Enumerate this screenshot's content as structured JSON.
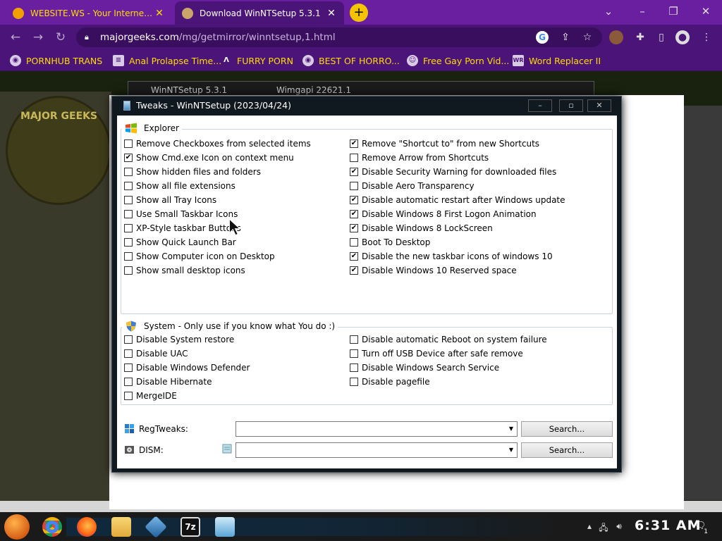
{
  "browser": {
    "tabs": [
      {
        "title": "WEBSITE.WS - Your Internet Ad",
        "active": false
      },
      {
        "title": "Download WinNTSetup 5.3.1",
        "active": true
      }
    ],
    "url_host": "majorgeeks.com",
    "url_path": "/mg/getmirror/winntsetup,1.html",
    "bookmarks": [
      "PORNHUB TRANS",
      "Anal Prolapse Time...",
      "FURRY PORN",
      "BEST OF HORRO...",
      "Free Gay Porn Vid...",
      "Word Replacer II"
    ],
    "colors": {
      "tabstrip": "#6a1fa0",
      "toolbar": "#4b1478",
      "bookmark_text": "#ffde00"
    }
  },
  "background_window": {
    "title": "WinNTSetup 5.3.1",
    "wimgapi": "Wimgapi 22621.1"
  },
  "dialog": {
    "title": "Tweaks - WinNTSetup (2023/04/24)",
    "explorer": {
      "legend": "Explorer",
      "left": [
        {
          "label": "Remove Checkboxes from selected items",
          "checked": false
        },
        {
          "label": "Show Cmd.exe Icon on context menu",
          "checked": true
        },
        {
          "label": "Show hidden files and folders",
          "checked": false
        },
        {
          "label": "Show all file extensions",
          "checked": false
        },
        {
          "label": "Show all Tray Icons",
          "checked": false
        },
        {
          "label": "Use Small Taskbar Icons",
          "checked": false
        },
        {
          "label": "XP-Style taskbar Buttons",
          "checked": false
        },
        {
          "label": "Show Quick Launch Bar",
          "checked": false
        },
        {
          "label": "Show Computer icon on Desktop",
          "checked": false
        },
        {
          "label": "Show small desktop icons",
          "checked": false
        }
      ],
      "right": [
        {
          "label": "Remove \"Shortcut to\" from new Shortcuts",
          "checked": true
        },
        {
          "label": "Remove Arrow from Shortcuts",
          "checked": false
        },
        {
          "label": "Disable Security Warning for downloaded files",
          "checked": true
        },
        {
          "label": "Disable Aero Transparency",
          "checked": false
        },
        {
          "label": "Disable automatic restart after Windows update",
          "checked": true
        },
        {
          "label": "Disable Windows 8 First Logon Animation",
          "checked": true
        },
        {
          "label": "Disable Windows 8 LockScreen",
          "checked": true
        },
        {
          "label": "Boot To Desktop",
          "checked": false
        },
        {
          "label": "Disable the new taskbar icons of windows 10",
          "checked": true
        },
        {
          "label": "Disable Windows 10 Reserved space",
          "checked": true
        }
      ]
    },
    "system": {
      "legend": "System - Only use if you know what You do :)",
      "left": [
        {
          "label": "Disable System restore",
          "checked": false
        },
        {
          "label": "Disable UAC",
          "checked": false
        },
        {
          "label": "Disable Windows Defender",
          "checked": false
        },
        {
          "label": "Disable Hibernate",
          "checked": false
        },
        {
          "label": "MergeIDE",
          "checked": false
        }
      ],
      "right": [
        {
          "label": "Disable automatic Reboot on system failure",
          "checked": false
        },
        {
          "label": "Turn off USB Device after safe remove",
          "checked": false
        },
        {
          "label": "Disable Windows Search Service",
          "checked": false
        },
        {
          "label": "Disable pagefile",
          "checked": false
        }
      ]
    },
    "regtweaks": {
      "label": "RegTweaks:",
      "value": "",
      "button": "Search..."
    },
    "dism": {
      "label": "DISM:",
      "value": "",
      "button": "Search..."
    }
  },
  "taskbar": {
    "clock": "6:31 AM",
    "notification_count": "1"
  }
}
